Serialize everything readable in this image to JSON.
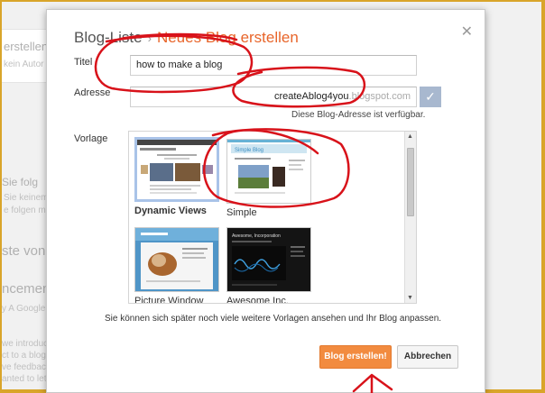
{
  "background": {
    "left_items": [
      "erstellen",
      "kein Autor",
      "Sie folg",
      "Sie keinem",
      "e folgen mö",
      "ste von",
      "ncemen",
      "y A Google",
      "we introduc",
      "ct to a blog",
      "ve feedback",
      "anted to let"
    ]
  },
  "dialog": {
    "breadcrumb_parent": "Blog-Liste",
    "breadcrumb_separator": "›",
    "breadcrumb_current": "Neues Blog erstellen",
    "close_glyph": "✕",
    "title_label": "Titel",
    "title_value": "how to make a blog",
    "address_label": "Adresse",
    "address_value": "createAblog4you",
    "address_domain": ".blogspot.com",
    "check_glyph": "✓",
    "address_status": "Diese Blog-Adresse ist verfügbar.",
    "template_label": "Vorlage",
    "templates": [
      {
        "name": "Dynamic Views",
        "selected": true
      },
      {
        "name": "Simple",
        "selected": false
      },
      {
        "name": "Picture Window",
        "selected": false
      },
      {
        "name": "Awesome Inc.",
        "selected": false
      }
    ],
    "simple_preview_heading": "Simple Blog",
    "awesome_preview_heading": "Awesome, Incorporation",
    "hint": "Sie können sich später noch viele weitere Vorlagen ansehen und Ihr Blog anpassen.",
    "create_button": "Blog erstellen!",
    "cancel_button": "Abbrechen"
  },
  "colors": {
    "accent": "#e8652a",
    "primary_button": "#f28b3f",
    "annotation": "#d8121a",
    "frame": "#d9a52a"
  }
}
